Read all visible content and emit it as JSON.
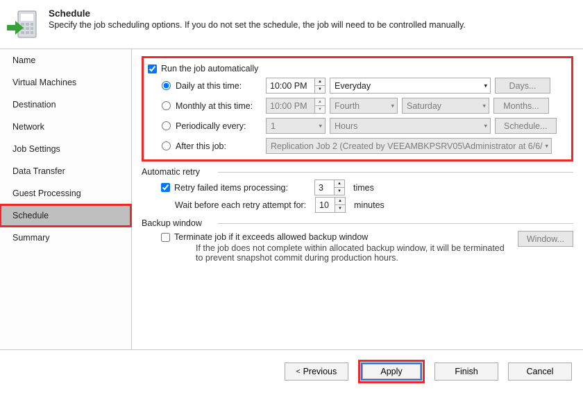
{
  "header": {
    "title": "Schedule",
    "subtitle": "Specify the job scheduling options. If you do not set the schedule, the job will need to be controlled manually."
  },
  "sidebar": {
    "items": [
      {
        "label": "Name"
      },
      {
        "label": "Virtual Machines"
      },
      {
        "label": "Destination"
      },
      {
        "label": "Network"
      },
      {
        "label": "Job Settings"
      },
      {
        "label": "Data Transfer"
      },
      {
        "label": "Guest Processing"
      },
      {
        "label": "Schedule"
      },
      {
        "label": "Summary"
      }
    ],
    "selected_index": 7
  },
  "schedule": {
    "run_auto_label": "Run the job automatically",
    "daily": {
      "label": "Daily at this time:",
      "time": "10:00 PM",
      "dayset": "Everyday",
      "days_btn": "Days..."
    },
    "monthly": {
      "label": "Monthly at this time:",
      "time": "10:00 PM",
      "ordinal": "Fourth",
      "day": "Saturday",
      "months_btn": "Months..."
    },
    "periodic": {
      "label": "Periodically every:",
      "value": "1",
      "unit": "Hours",
      "sched_btn": "Schedule..."
    },
    "after": {
      "label": "After this job:",
      "jobtext": "Replication Job 2 (Created by VEEAMBKPSRV05\\Administrator at 6/6/"
    }
  },
  "retry": {
    "section": "Automatic retry",
    "retry_label": "Retry failed items processing:",
    "retry_count": "3",
    "times": "times",
    "wait_label": "Wait before each retry attempt for:",
    "wait_count": "10",
    "minutes": "minutes"
  },
  "window": {
    "section": "Backup window",
    "terminate_label": "Terminate job if it exceeds allowed backup window",
    "window_btn": "Window...",
    "help_text": "If the job does not complete within allocated backup window, it will be terminated to prevent snapshot commit during production hours."
  },
  "footer": {
    "previous": "Previous",
    "apply": "Apply",
    "next": "Finish",
    "cancel": "Cancel"
  }
}
